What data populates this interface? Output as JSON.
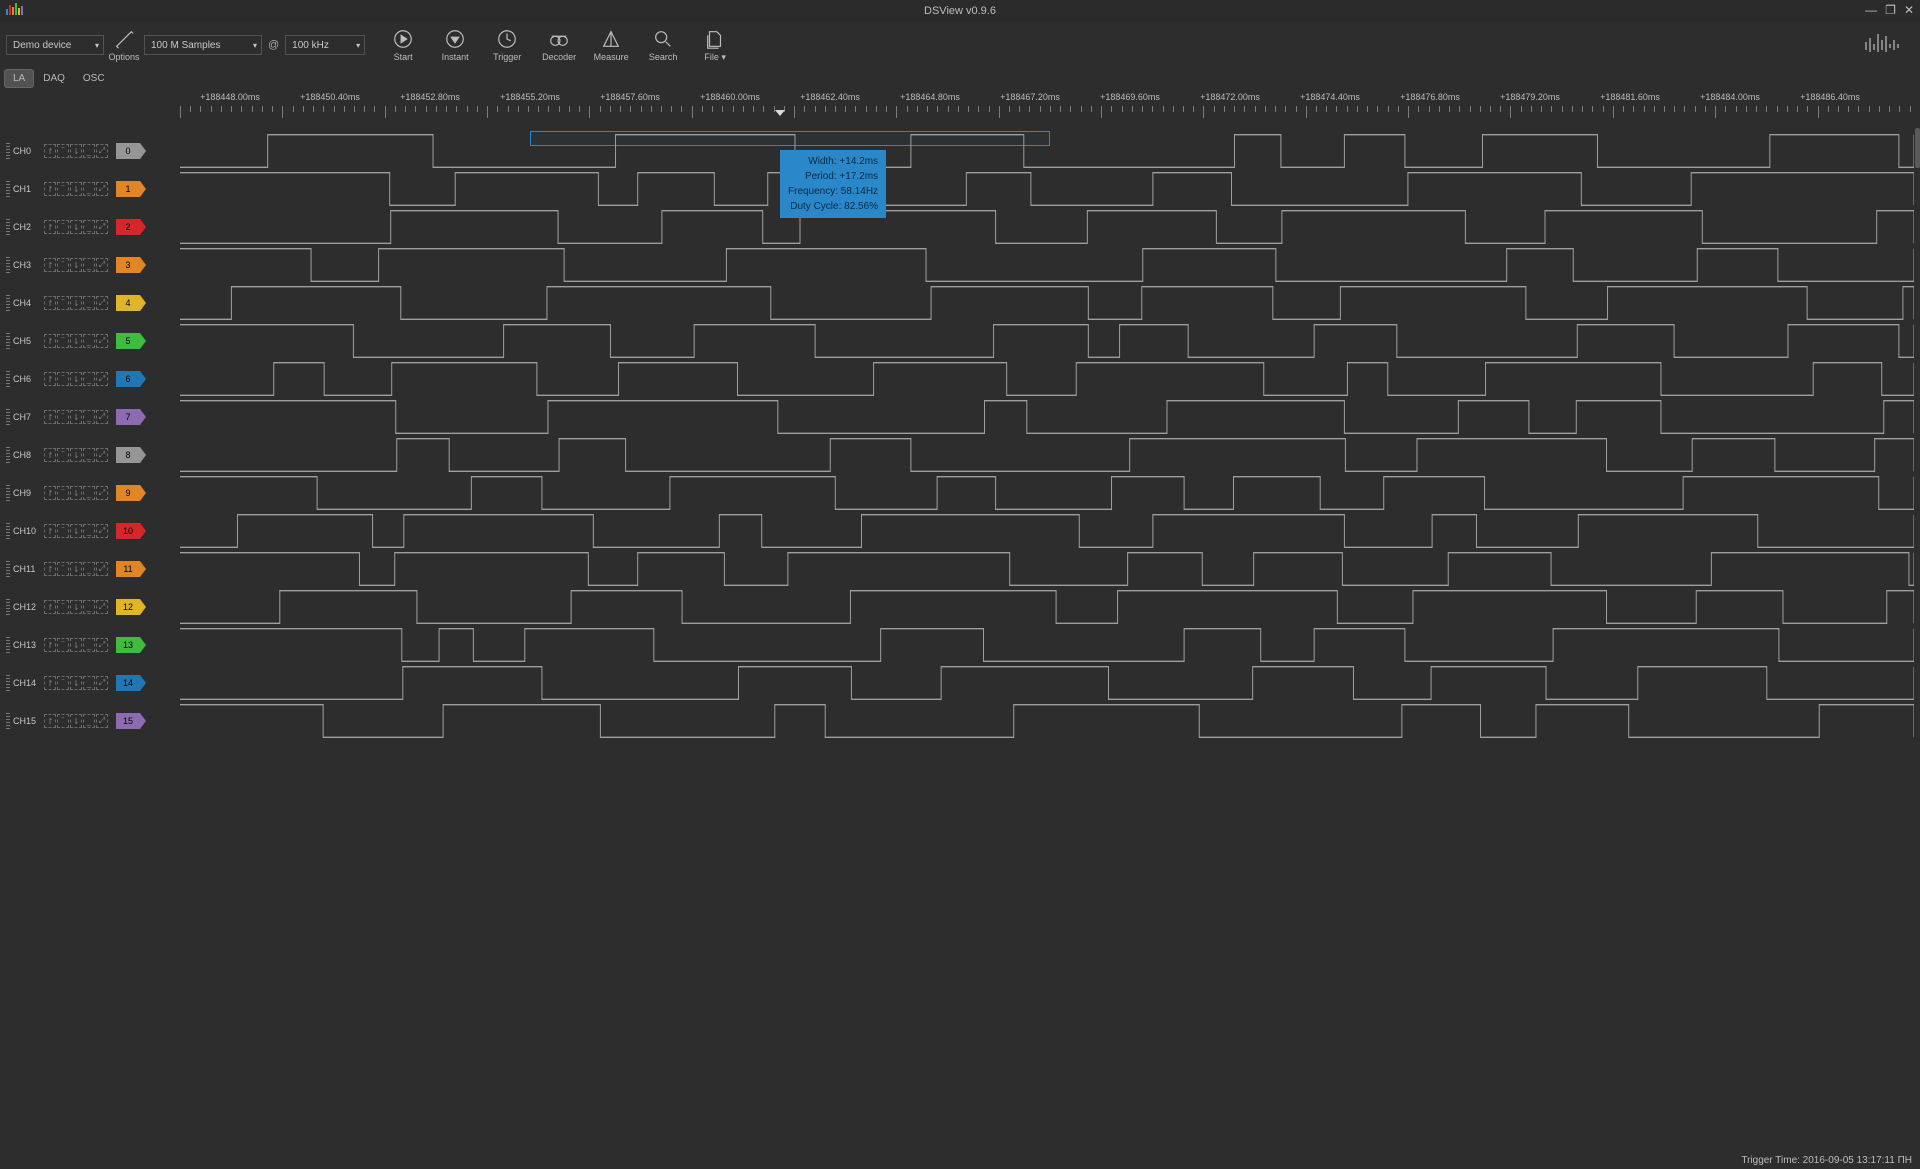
{
  "title": "DSView v0.9.6",
  "device_select": "Demo device",
  "samples_select": "100 M Samples",
  "rate_select": "100 kHz",
  "toolbar": {
    "options": "Options",
    "start": "Start",
    "instant": "Instant",
    "trigger": "Trigger",
    "decoder": "Decoder",
    "measure": "Measure",
    "search": "Search",
    "file": "File"
  },
  "mode_tabs": [
    "LA",
    "DAQ",
    "OSC"
  ],
  "active_mode": "LA",
  "ruler_labels": [
    "+188448.00ms",
    "+188450.40ms",
    "+188452.80ms",
    "+188455.20ms",
    "+188457.60ms",
    "+188460.00ms",
    "+188462.40ms",
    "+188464.80ms",
    "+188467.20ms",
    "+188469.60ms",
    "+188472.00ms",
    "+188474.40ms",
    "+188476.80ms",
    "+188479.20ms",
    "+188481.60ms",
    "+188484.00ms",
    "+188486.40ms"
  ],
  "trigger_icons": [
    "↾",
    "‾",
    "⇂",
    "_",
    "⤢"
  ],
  "channels": [
    {
      "id": "CH0",
      "num": "0",
      "color": "#969696"
    },
    {
      "id": "CH1",
      "num": "1",
      "color": "#e08627"
    },
    {
      "id": "CH2",
      "num": "2",
      "color": "#d62728"
    },
    {
      "id": "CH3",
      "num": "3",
      "color": "#e08627"
    },
    {
      "id": "CH4",
      "num": "4",
      "color": "#e0b628"
    },
    {
      "id": "CH5",
      "num": "5",
      "color": "#3fbb3f"
    },
    {
      "id": "CH6",
      "num": "6",
      "color": "#1f77b4"
    },
    {
      "id": "CH7",
      "num": "7",
      "color": "#8c6bb1"
    },
    {
      "id": "CH8",
      "num": "8",
      "color": "#969696"
    },
    {
      "id": "CH9",
      "num": "9",
      "color": "#e08627"
    },
    {
      "id": "CH10",
      "num": "10",
      "color": "#d62728"
    },
    {
      "id": "CH11",
      "num": "11",
      "color": "#e08627"
    },
    {
      "id": "CH12",
      "num": "12",
      "color": "#e0b628"
    },
    {
      "id": "CH13",
      "num": "13",
      "color": "#3fbb3f"
    },
    {
      "id": "CH14",
      "num": "14",
      "color": "#1f77b4"
    },
    {
      "id": "CH15",
      "num": "15",
      "color": "#8c6bb1"
    }
  ],
  "tooltip": {
    "width": "Width: +14.2ms",
    "period": "Period: +17.2ms",
    "frequency": "Frequency: 58.14Hz",
    "duty": "Duty Cycle: 82.56%"
  },
  "status": "Trigger Time: 2016-09-05 13:17:11 ПН"
}
